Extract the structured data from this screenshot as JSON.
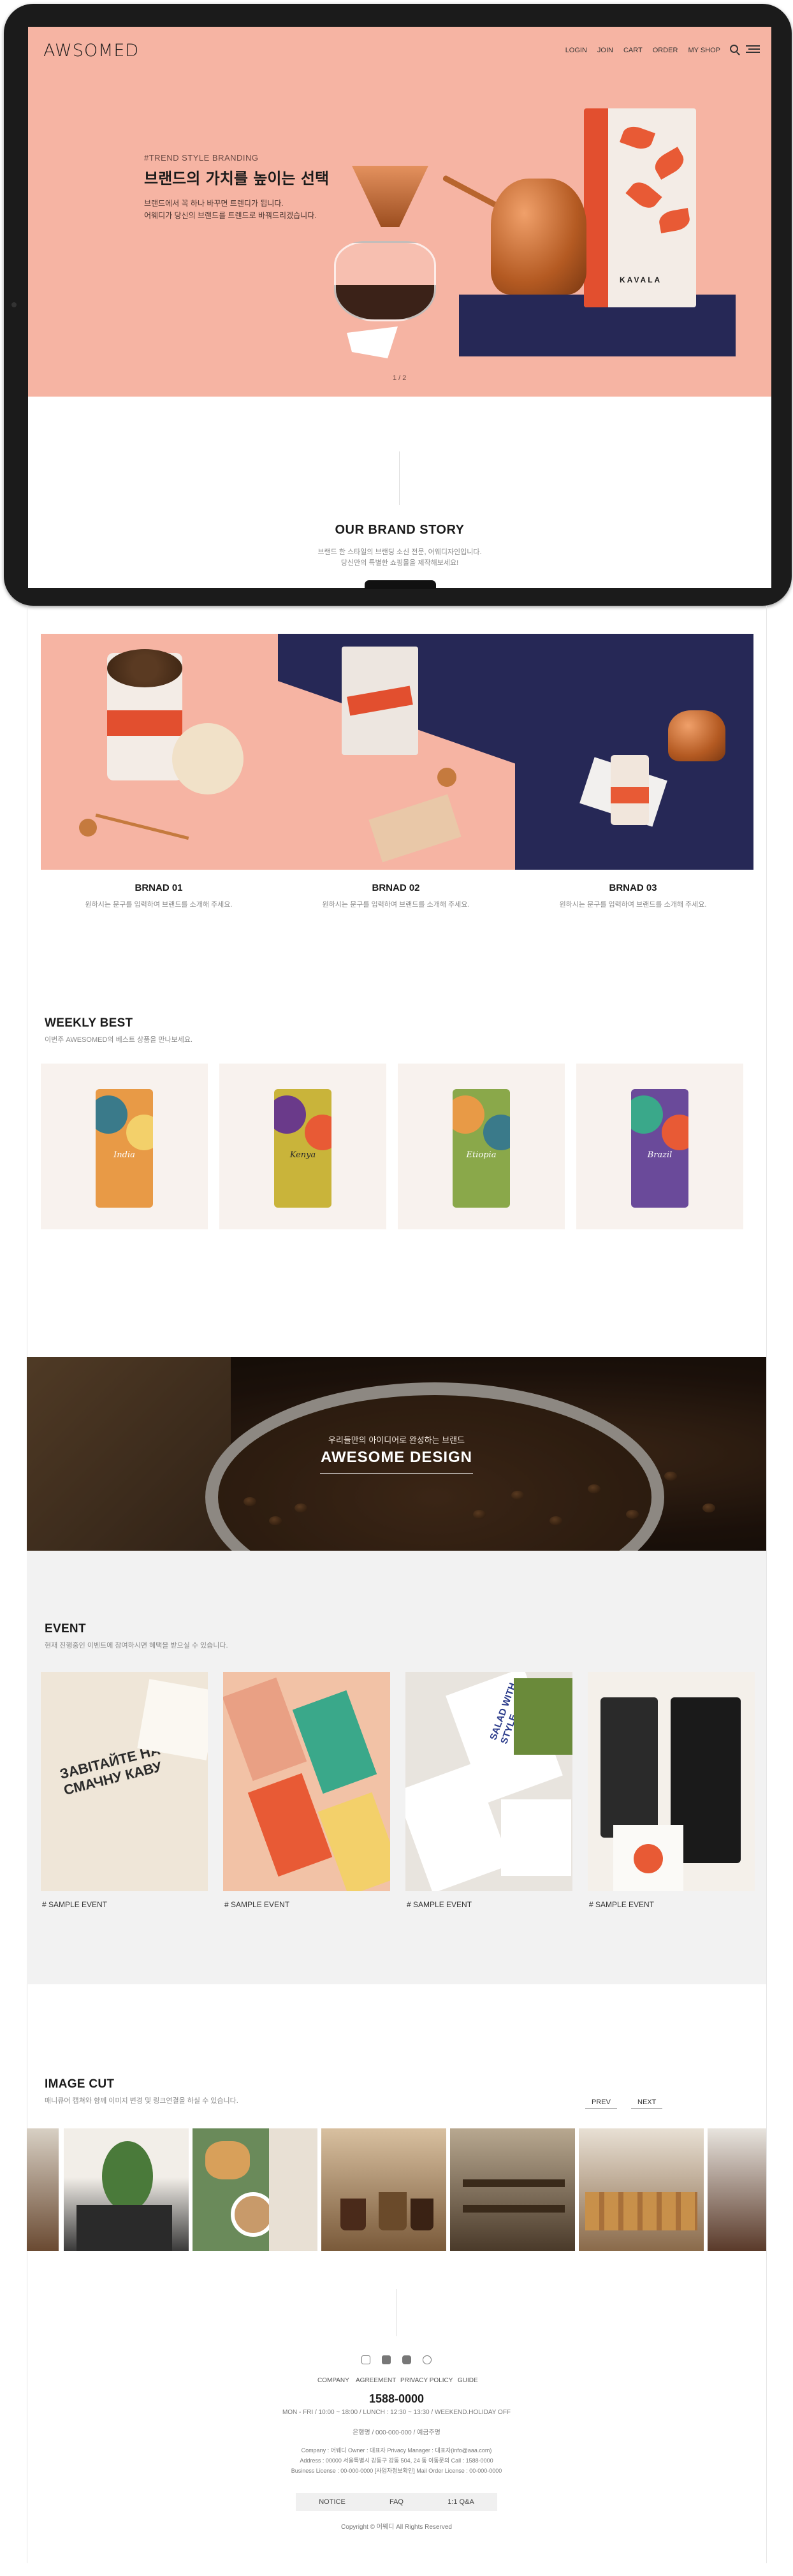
{
  "site": {
    "logo": "AWSOMED",
    "nav": [
      "LOGIN",
      "JOIN",
      "CART",
      "ORDER",
      "MY SHOP"
    ]
  },
  "hero": {
    "kicker": "#TREND STYLE BRANDING",
    "title": "브랜드의 가치를 높이는 선택",
    "desc_line1": "브랜드에서 꼭 하나 바꾸면 트렌디가 됩니다.",
    "desc_line2": "어웨디가 당신의 브랜드를 트렌드로 바꿔드리겠습니다.",
    "pager": "1 / 2",
    "bag_label": "KAVALA",
    "colors": {
      "pink": "#f6b4a3",
      "navy": "#262856"
    }
  },
  "brand_story": {
    "title": "OUR BRAND STORY",
    "sub_line1": "브랜드 한 스타일의 브랜딩 소신 전문, 어웨디자인입니다.",
    "sub_line2": "당신만의 특별한 쇼핑몰을 제작해보세요!",
    "brands": [
      {
        "label": "BRNAD 01",
        "desc": "원하시는 문구를 입력하여 브랜드를 소개해 주세요."
      },
      {
        "label": "BRNAD 02",
        "desc": "원하시는 문구를 입력하여 브랜드를 소개해 주세요."
      },
      {
        "label": "BRNAD 03",
        "desc": "원하시는 문구를 입력하여 브랜드를 소개해 주세요."
      }
    ]
  },
  "weekly_best": {
    "title": "WEEKLY BEST",
    "sub": "이번주 AWESOMED의 베스트 상품을 만나보세요.",
    "products": [
      {
        "name": "India"
      },
      {
        "name": "Kenya"
      },
      {
        "name": "Etiopia"
      },
      {
        "name": "Brazil"
      }
    ]
  },
  "banner": {
    "kicker": "우리들만의 아이디어로 완성하는 브랜드",
    "title": "AWESOME DESIGN"
  },
  "event": {
    "title": "EVENT",
    "sub": "현재 진행중인 이벤트에 참여하시면 혜택을 받으실 수 있습니다.",
    "items": [
      {
        "tag": "# SAMPLE EVENT"
      },
      {
        "tag": "# SAMPLE EVENT"
      },
      {
        "tag": "# SAMPLE EVENT"
      },
      {
        "tag": "# SAMPLE EVENT"
      }
    ],
    "poster_text": "ЗАВІТАЙТЕ НА СМАЧНУ КАВУ",
    "box_text": "SALAD WITH STYLE"
  },
  "image_cut": {
    "title": "IMAGE CUT",
    "sub": "매니큐어 캡쳐와 함께 이미지 변경 및 링크연결을 하실 수 있습니다.",
    "prev": "PREV",
    "next": "NEXT"
  },
  "footer": {
    "links": [
      "COMPANY",
      "AGREEMENT",
      "PRIVACY POLICY",
      "GUIDE"
    ],
    "phone": "1588-0000",
    "hours": "MON - FRI / 10:00 ~ 18:00 / LUNCH : 12:30 ~ 13:30 / WEEKEND.HOLIDAY OFF",
    "bank": "은행명 / 000-000-000 / 예금주명",
    "company_line": "Company : 어웨디    Owner : 대표자    Privacy Manager : 대표자(info@aaa.com)",
    "address_line": "Address : 00000 서울특별시 강동구 강동 504, 24 동 이동문의    Call : 1588-0000",
    "license_line": "Business License : 00-000-0000 [사업자정보확인]    Mail Order License : 00-000-0000",
    "buttons": [
      "NOTICE",
      "FAQ",
      "1:1 Q&A"
    ],
    "copyright": "Copyright © 어웨디 All Rights Reserved"
  }
}
